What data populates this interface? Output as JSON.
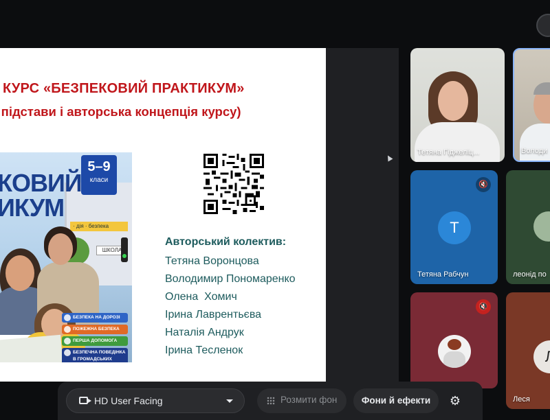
{
  "slide": {
    "title": "КУРС «БЕЗПЕКОВИЙ ПРАКТИКУМ»",
    "subtitle": "ві підстави і авторська концепція курсу)",
    "cover": {
      "title_line1": "КОВИЙ",
      "title_line2": "ИКУМ",
      "grade": "5–9",
      "grade_label": "класи",
      "tagline": "· дія · безпека",
      "school_sign": "ШКОЛА",
      "badges": [
        "БЕЗПЕКА НА ДОРОЗІ",
        "ПОЖЕЖНА БЕЗПЕКА",
        "ПЕРША ДОПОМОГА",
        "БЕЗПЕЧНА ПОВЕДІНКА В ГРОМАДСЬКИХ МІСЦЯХ І ТРАНСПОРТІ"
      ]
    },
    "authors_heading": "Авторський колектив:",
    "authors": [
      "Тетяна Воронцова",
      "Володимир Пономаренко",
      "Олена  Хомич",
      "Ірина Лаврентьєва",
      "Наталія Андрук",
      "Ірина Тесленок"
    ]
  },
  "participants": [
    {
      "name": "Тетяна Гіджеліц..."
    },
    {
      "name": "Володи"
    },
    {
      "name": "Тетяна Рабчун",
      "avatar_letter": "Т",
      "avatar_color": "#2b87d8",
      "muted": true
    },
    {
      "name": "леонід по"
    },
    {
      "name": "",
      "muted": true
    },
    {
      "name": "Леся",
      "avatar_letter": "Л"
    }
  ],
  "toolbar": {
    "camera_label": "HD User Facing",
    "blur_label": "Розмити фон",
    "backgrounds_label": "Фони й ефекти"
  },
  "colors": {
    "title_red": "#c0161b",
    "author_teal": "#1d5b5d",
    "active_speaker_border": "#8ab4f8",
    "tile_blue": "#1e64a8",
    "tile_maroon": "#7a2a35"
  },
  "icons": [
    "video-camera-icon",
    "chevron-down-icon",
    "blur-icon",
    "gear-icon",
    "mic-off-icon"
  ]
}
